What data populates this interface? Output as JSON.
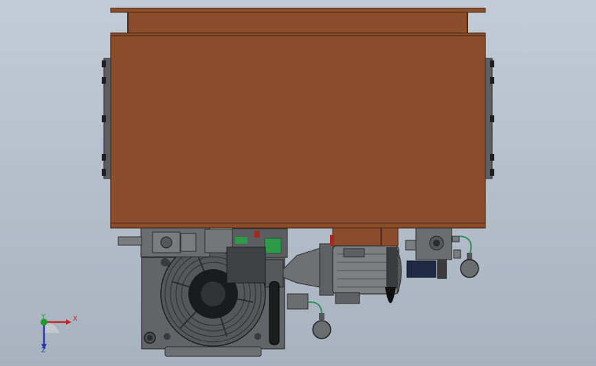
{
  "viewport": {
    "background_top": "#c3cbd6",
    "background_bottom": "#a8b2bf"
  },
  "model": {
    "tank_color": "#8b4d2b",
    "tank_edge": "#4a2a18",
    "steel_color": "#6b6d70",
    "dark_steel": "#3a3b3d",
    "valve_green": "#2e9a4a",
    "motor_grey": "#7d8083",
    "hose_green": "#2f8f52"
  },
  "triad": {
    "x_label": "X",
    "y_label": "Y",
    "z_label": "Z",
    "x_color": "#c0282b",
    "y_color": "#1f9c2c",
    "z_color": "#2737a8"
  }
}
